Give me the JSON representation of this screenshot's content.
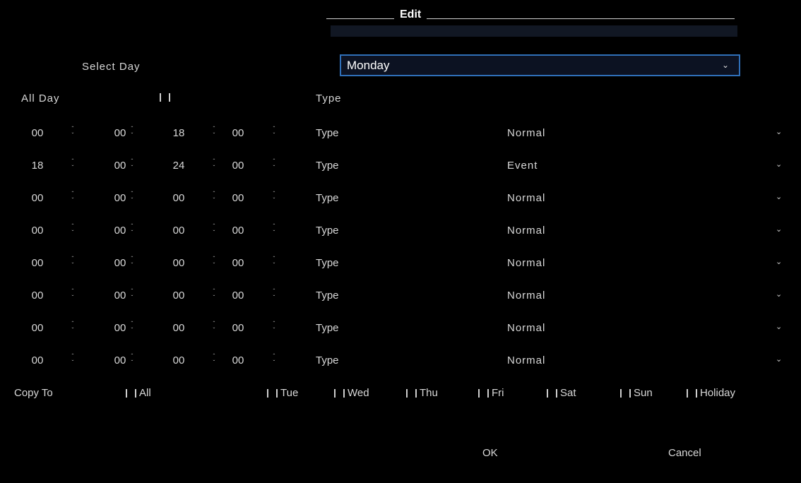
{
  "dialog": {
    "title": "Edit"
  },
  "select_day": {
    "label": "Select Day",
    "value": "Monday"
  },
  "all_day": {
    "label": "All Day",
    "type_label": "Type"
  },
  "rows": [
    {
      "sh": "00",
      "sm": "00",
      "eh": "18",
      "em": "00",
      "type_label": "Type",
      "type": "Normal"
    },
    {
      "sh": "18",
      "sm": "00",
      "eh": "24",
      "em": "00",
      "type_label": "Type",
      "type": "Event"
    },
    {
      "sh": "00",
      "sm": "00",
      "eh": "00",
      "em": "00",
      "type_label": "Type",
      "type": "Normal"
    },
    {
      "sh": "00",
      "sm": "00",
      "eh": "00",
      "em": "00",
      "type_label": "Type",
      "type": "Normal"
    },
    {
      "sh": "00",
      "sm": "00",
      "eh": "00",
      "em": "00",
      "type_label": "Type",
      "type": "Normal"
    },
    {
      "sh": "00",
      "sm": "00",
      "eh": "00",
      "em": "00",
      "type_label": "Type",
      "type": "Normal"
    },
    {
      "sh": "00",
      "sm": "00",
      "eh": "00",
      "em": "00",
      "type_label": "Type",
      "type": "Normal"
    },
    {
      "sh": "00",
      "sm": "00",
      "eh": "00",
      "em": "00",
      "type_label": "Type",
      "type": "Normal"
    }
  ],
  "copy_to": {
    "label": "Copy To",
    "options": [
      "All",
      "Tue",
      "Wed",
      "Thu",
      "Fri",
      "Sat",
      "Sun",
      "Holiday"
    ]
  },
  "buttons": {
    "ok": "OK",
    "cancel": "Cancel"
  },
  "icons": {
    "spin": "spin-arrows-icon",
    "chevron": "chevron-down-icon"
  },
  "colors": {
    "background": "#000000",
    "accent_border": "#2f6fb8",
    "text": "#d8d8d8"
  }
}
